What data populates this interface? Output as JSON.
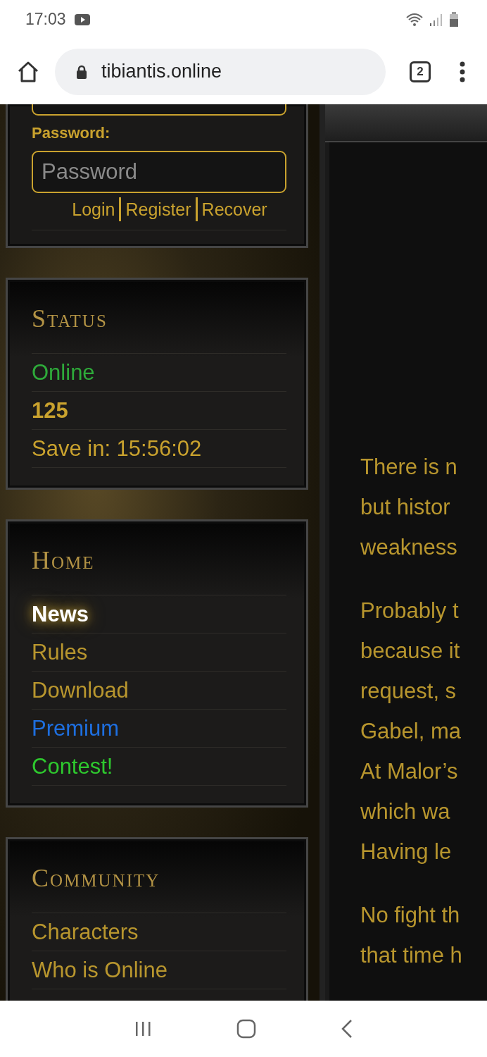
{
  "status_bar": {
    "time": "17:03"
  },
  "browser": {
    "url": "tibiantis.online",
    "tab_count": "2"
  },
  "login": {
    "password_label": "Password:",
    "password_placeholder": "Password",
    "links": [
      "Login",
      "Register",
      "Recover"
    ]
  },
  "status_panel": {
    "title": "Status",
    "rows": [
      {
        "text": "Online",
        "kind": "state"
      },
      {
        "text": "125",
        "kind": "count"
      },
      {
        "text": "Save in: 15:56:02",
        "kind": "text"
      }
    ]
  },
  "home_panel": {
    "title": "Home",
    "items": [
      {
        "label": "News",
        "selected": true,
        "color": "#ffffff"
      },
      {
        "label": "Rules",
        "selected": false,
        "color": "#b8962e"
      },
      {
        "label": "Download",
        "selected": false,
        "color": "#b8962e"
      },
      {
        "label": "Premium",
        "selected": false,
        "color": "#1e6fe0"
      },
      {
        "label": "Contest!",
        "selected": false,
        "color": "#2ec82e"
      }
    ]
  },
  "community_panel": {
    "title": "Community",
    "items": [
      {
        "label": "Characters",
        "selected": false
      },
      {
        "label": "Who is Online",
        "selected": false
      }
    ]
  },
  "article": {
    "paragraphs": [
      [
        "There is n",
        "but histor",
        "weakness"
      ],
      [
        "Probably t",
        "because it",
        "request, s",
        "Gabel, ma",
        "At Malor’s",
        "which wa",
        "Having le"
      ],
      [
        "No fight th",
        "that time h"
      ]
    ]
  }
}
